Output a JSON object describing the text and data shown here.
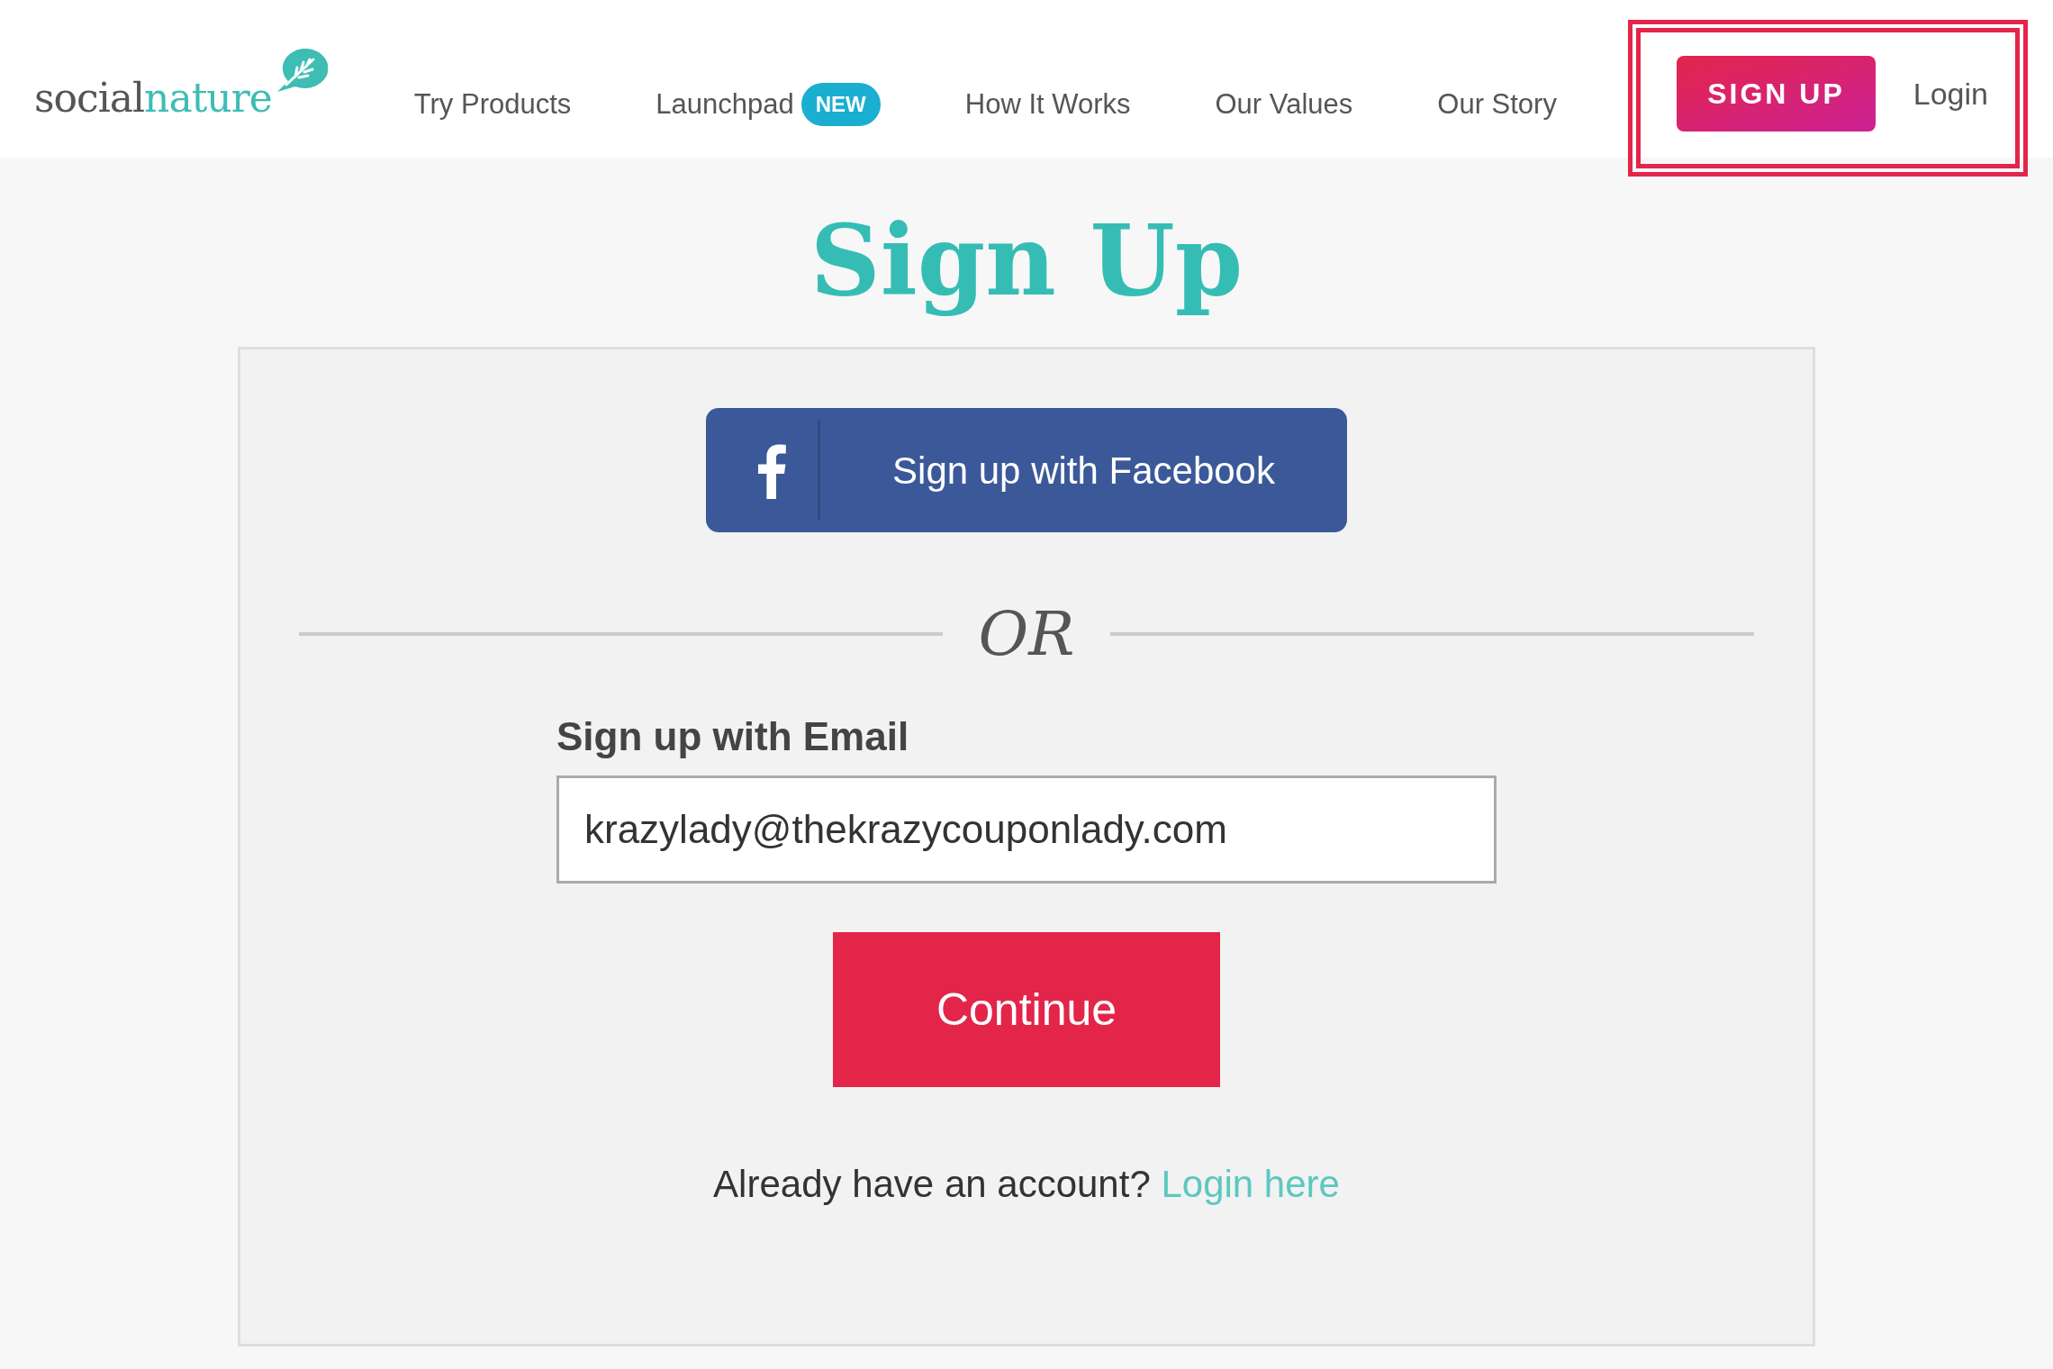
{
  "header": {
    "logo": {
      "text_1": "social",
      "text_2": "nature"
    },
    "nav_items": [
      {
        "label": "Try Products"
      },
      {
        "label": "Launchpad",
        "badge": "NEW"
      },
      {
        "label": "How It Works"
      },
      {
        "label": "Our Values"
      },
      {
        "label": "Our Story"
      }
    ],
    "actions": {
      "highlighted": true,
      "signup_button": "SIGN UP",
      "login_link": "Login"
    }
  },
  "title": "Sign Up",
  "form": {
    "facebook_button": "Sign up with Facebook",
    "divider": "OR",
    "email_label": "Sign up with Email",
    "email_value": "krazylady@thekrazycouponlady.com",
    "continue_button": "Continue",
    "login_prompt": {
      "text": "Already have an account?",
      "link": "Login here"
    }
  }
}
